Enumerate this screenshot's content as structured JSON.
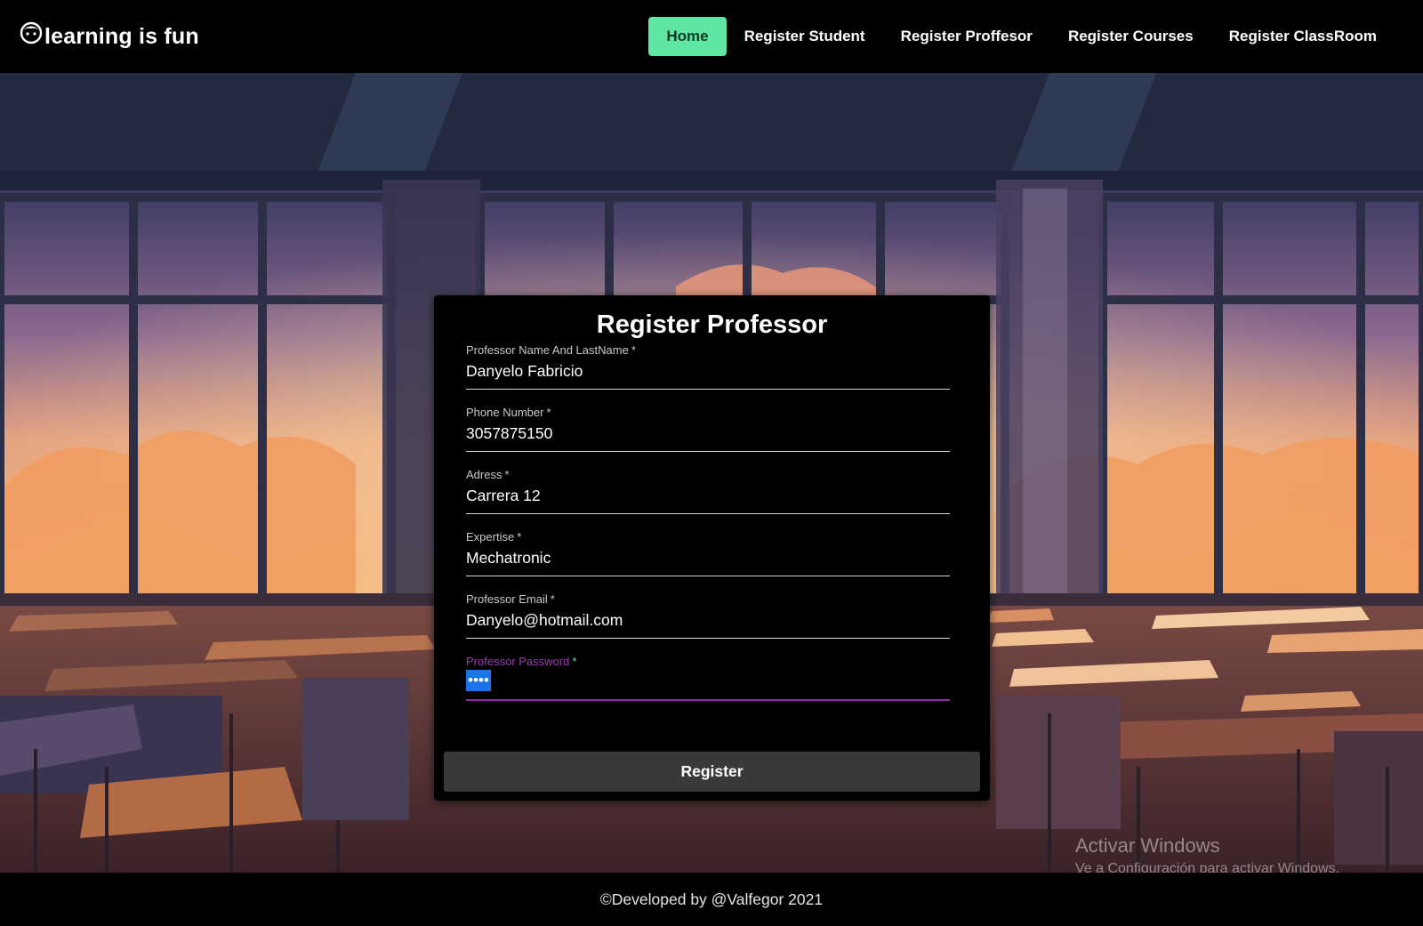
{
  "navbar": {
    "brand": "learning is fun",
    "brand_icon": "smiley-face-icon",
    "links": [
      {
        "label": "Home",
        "active": true
      },
      {
        "label": "Register Student",
        "active": false
      },
      {
        "label": "Register Proffesor",
        "active": false
      },
      {
        "label": "Register Courses",
        "active": false
      },
      {
        "label": "Register ClassRoom",
        "active": false
      }
    ],
    "active_color": "#5ee6a2"
  },
  "form": {
    "title": "Register Professor",
    "fields": [
      {
        "label": "Professor Name And LastName",
        "required": "*",
        "value": "Danyelo Fabricio"
      },
      {
        "label": "Phone Number",
        "required": "*",
        "value": "3057875150"
      },
      {
        "label": "Adress",
        "required": "*",
        "value": "Carrera 12"
      },
      {
        "label": "Expertise",
        "required": "*",
        "value": "Mechatronic"
      },
      {
        "label": "Professor Email",
        "required": "*",
        "value": "Danyelo@hotmail.com"
      },
      {
        "label": "Professor Password",
        "required": "*",
        "value": "••••",
        "focused": true
      }
    ],
    "submit_label": "Register",
    "focus_color": "#8e2ba3"
  },
  "watermark": {
    "title": "Activar Windows",
    "subtitle": "Ve a Configuración para activar Windows."
  },
  "footer": {
    "text": "©Developed by @Valfegor 2021"
  }
}
